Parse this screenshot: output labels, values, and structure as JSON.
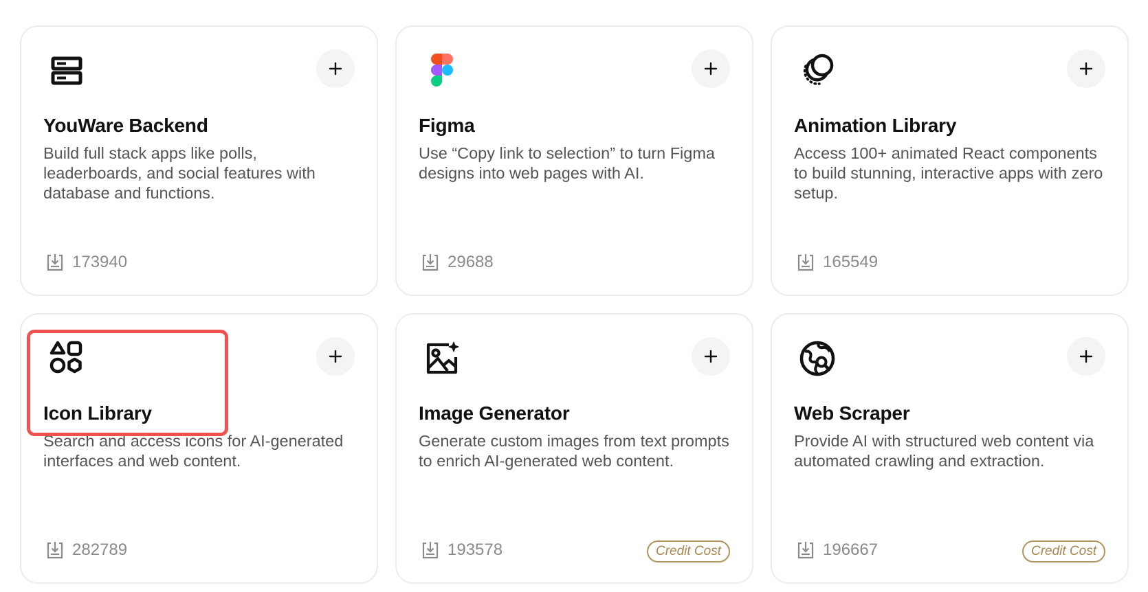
{
  "colors": {
    "card_border": "#ececec",
    "add_button_bg": "#f4f4f4",
    "title": "#111111",
    "description": "#555555",
    "download_count": "#8a8a8a",
    "credit_badge": "#a8864d",
    "highlight": "#ef5151"
  },
  "cards": [
    {
      "icon": "server-stack-icon",
      "title": "YouWare Backend",
      "description": "Build full stack apps like polls, leaderboards, and social features with database and functions.",
      "downloads": "173940",
      "add_icon": "plus-icon"
    },
    {
      "icon": "figma-logo-icon",
      "title": "Figma",
      "description": "Use “Copy link to selection” to turn Figma designs into web pages with AI.",
      "downloads": "29688",
      "add_icon": "plus-icon"
    },
    {
      "icon": "animation-circles-icon",
      "title": "Animation Library",
      "description": "Access 100+ animated React components to build stunning, interactive apps with zero setup.",
      "downloads": "165549",
      "add_icon": "plus-icon"
    },
    {
      "icon": "shapes-icon",
      "title": "Icon Library",
      "description": "Search and access icons for AI-generated interfaces and web content.",
      "downloads": "282789",
      "add_icon": "plus-icon",
      "highlighted": true
    },
    {
      "icon": "image-sparkle-icon",
      "title": "Image Generator",
      "description": "Generate custom images from text prompts to enrich AI-generated web content.",
      "downloads": "193578",
      "badge": "Credit Cost",
      "add_icon": "plus-icon"
    },
    {
      "icon": "globe-search-icon",
      "title": "Web Scraper",
      "description": "Provide AI with structured web content via automated crawling and extraction.",
      "downloads": "196667",
      "badge": "Credit Cost",
      "add_icon": "plus-icon"
    }
  ]
}
